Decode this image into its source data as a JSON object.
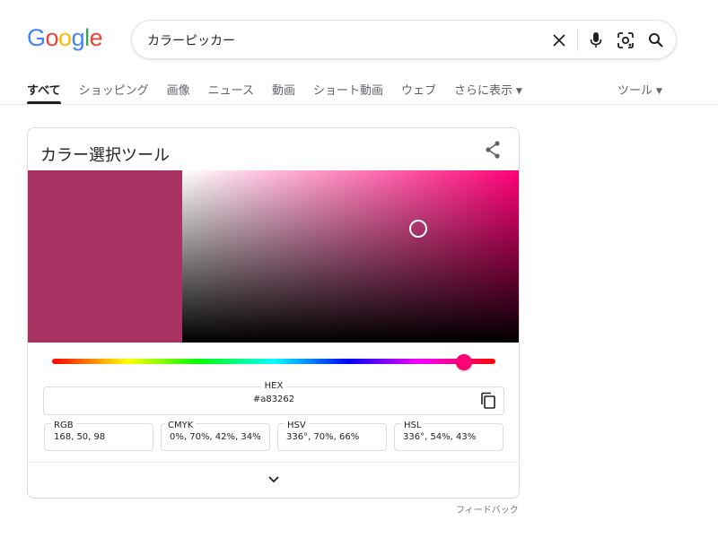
{
  "logo": {
    "letters": [
      "G",
      "o",
      "o",
      "g",
      "l",
      "e"
    ],
    "colors": [
      "#4285f4",
      "#ea4335",
      "#fbbc05",
      "#4285f4",
      "#34a853",
      "#ea4335"
    ]
  },
  "search": {
    "query": "カラーピッカー",
    "icons": [
      "close-icon",
      "mic-icon",
      "lens-icon",
      "search-icon"
    ]
  },
  "tabs": [
    {
      "label": "すべて",
      "active": true
    },
    {
      "label": "ショッピング"
    },
    {
      "label": "画像"
    },
    {
      "label": "ニュース"
    },
    {
      "label": "動画"
    },
    {
      "label": "ショート動画"
    },
    {
      "label": "ウェブ"
    },
    {
      "label": "さらに表示"
    }
  ],
  "tools_label": "ツール",
  "picker": {
    "title": "カラー選択ツール",
    "selected_color": "#a83262",
    "hue_color": "#ff0077",
    "hue_fraction": 0.93,
    "saturation_percent": 70,
    "value_percent": 66,
    "hex_label": "HEX",
    "hex_value": "#a83262",
    "fields": [
      {
        "label": "RGB",
        "value": "168, 50, 98"
      },
      {
        "label": "CMYK",
        "value": "0%, 70%, 42%, 34%"
      },
      {
        "label": "HSV",
        "value": "336°, 70%, 66%"
      },
      {
        "label": "HSL",
        "value": "336°, 54%, 43%"
      }
    ]
  },
  "feedback": "フィードバック"
}
